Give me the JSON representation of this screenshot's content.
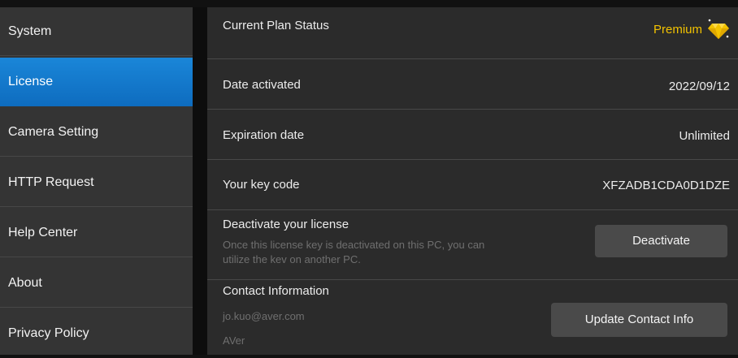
{
  "sidebar": {
    "items": [
      {
        "label": "System"
      },
      {
        "label": "License"
      },
      {
        "label": "Camera Setting"
      },
      {
        "label": "HTTP Request"
      },
      {
        "label": "Help Center"
      },
      {
        "label": "About"
      },
      {
        "label": "Privacy Policy"
      }
    ],
    "active_index": 1
  },
  "plan": {
    "label": "Current Plan Status",
    "value": "Premium",
    "icon": "diamond-icon"
  },
  "activated": {
    "label": "Date activated",
    "value": "2022/09/12"
  },
  "expiration": {
    "label": "Expiration date",
    "value": "Unlimited"
  },
  "key_code": {
    "label": "Your key code",
    "value": "XFZADB1CDA0D1DZE"
  },
  "deactivate": {
    "label": "Deactivate your license",
    "description_line1": "Once this license key is deactivated on this PC, you can",
    "description_line2": "utilize the kev on another PC.",
    "button_label": "Deactivate"
  },
  "contact": {
    "label": "Contact Information",
    "email": "jo.kuo@aver.com",
    "company": "AVer",
    "button_label": "Update Contact Info"
  },
  "colors": {
    "accent": "#1a86d8",
    "premium": "#f2c200",
    "background": "#2b2b2b",
    "sidebar": "#343434"
  }
}
